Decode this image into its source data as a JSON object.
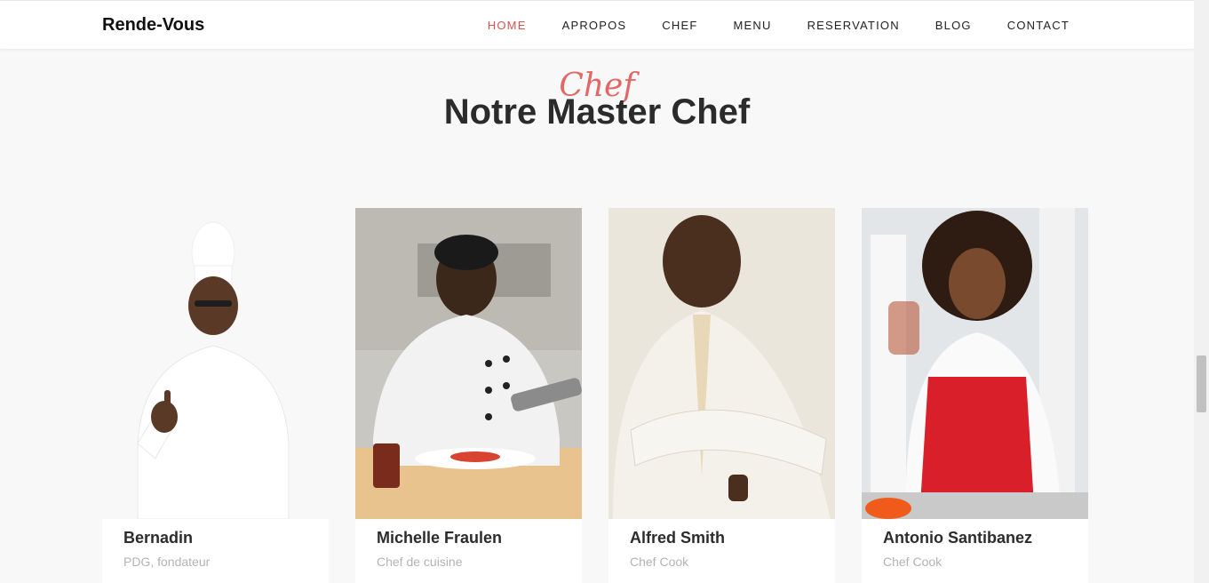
{
  "brand": "Rende-Vous",
  "nav": [
    {
      "label": "HOME"
    },
    {
      "label": "APROPOS"
    },
    {
      "label": "CHEF"
    },
    {
      "label": "MENU"
    },
    {
      "label": "RESERVATION"
    },
    {
      "label": "BLOG"
    },
    {
      "label": "CONTACT"
    }
  ],
  "section": {
    "subtitle": "Chef",
    "title": "Notre Master Chef"
  },
  "chefs": [
    {
      "name": "Bernadin",
      "role": "PDG, fondateur"
    },
    {
      "name": "Michelle Fraulen",
      "role": "Chef de cuisine"
    },
    {
      "name": "Alfred Smith",
      "role": "Chef Cook"
    },
    {
      "name": "Antonio Santibanez",
      "role": "Chef Cook"
    }
  ],
  "colors": {
    "accent": "#d9534f",
    "script": "#e46767",
    "title": "#2b2b2b",
    "muted": "#b3b3b3"
  }
}
